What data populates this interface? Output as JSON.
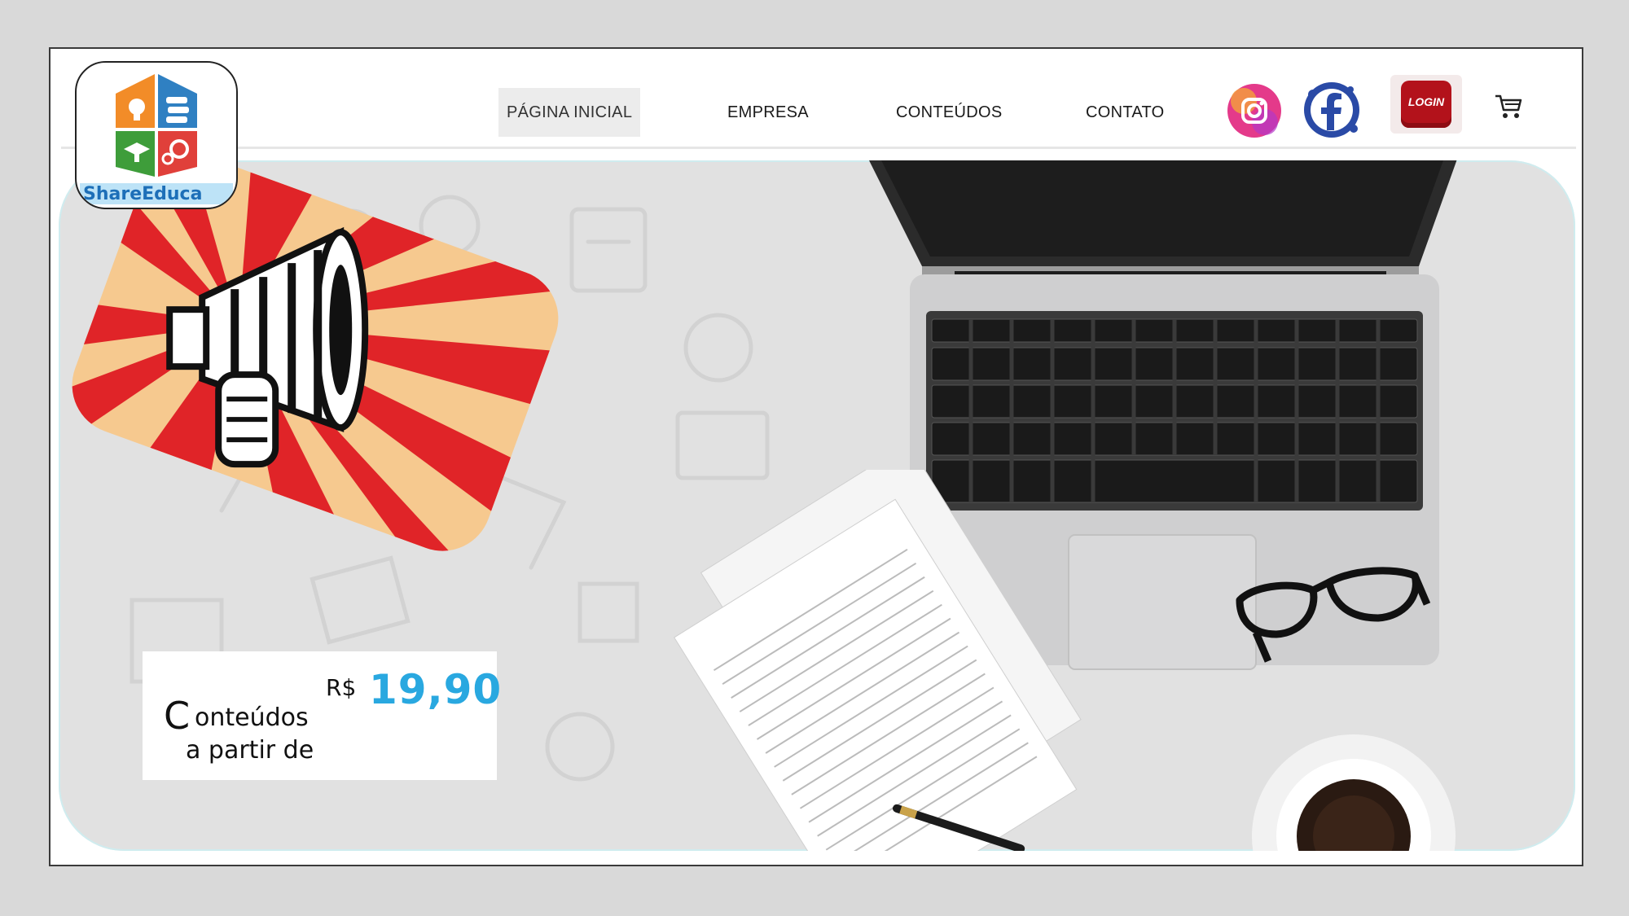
{
  "brand": {
    "logo_text": "ShareEduca"
  },
  "nav": {
    "items": [
      {
        "label": "PÁGINA INICIAL",
        "active": true
      },
      {
        "label": "EMPRESA",
        "active": false
      },
      {
        "label": "CONTEÚDOS",
        "active": false
      },
      {
        "label": "CONTATO",
        "active": false
      }
    ]
  },
  "header_actions": {
    "instagram_icon": "instagram-icon",
    "facebook_icon": "facebook-icon",
    "login_label": "LOGIN",
    "cart_icon": "cart-icon"
  },
  "promo": {
    "line1": "onteúdos",
    "line1_initial": "C",
    "line2": "a partir de",
    "currency": "R$",
    "price": "19,90"
  },
  "colors": {
    "price": "#29a8e0",
    "login_bg": "#b3121b",
    "megaphone_red": "#e02428",
    "megaphone_cream": "#f6c98f"
  }
}
